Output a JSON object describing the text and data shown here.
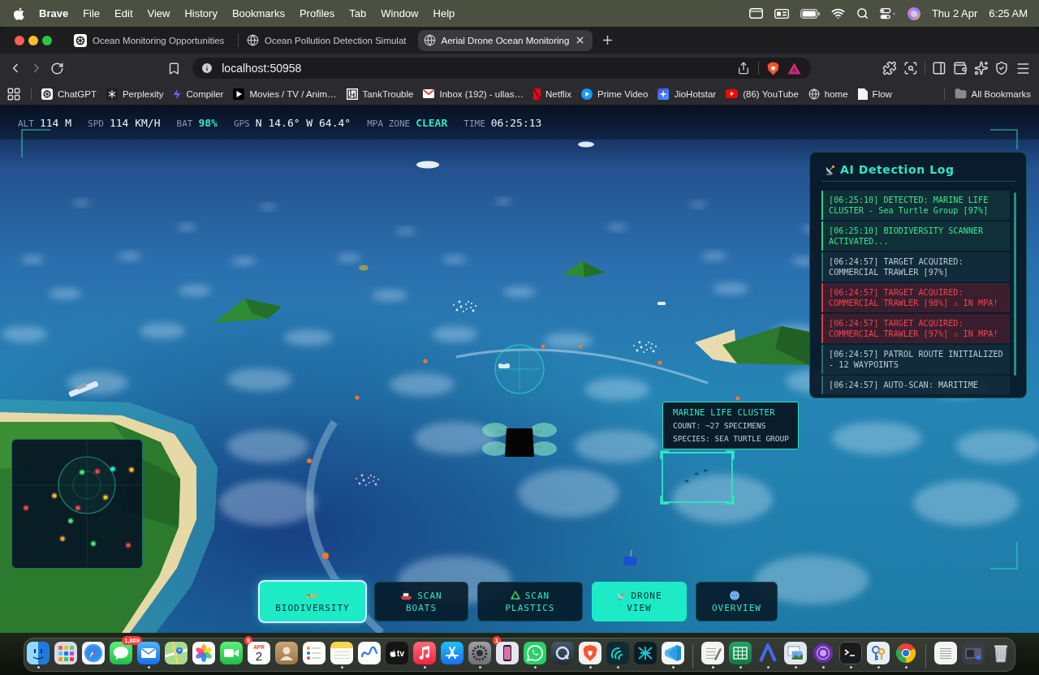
{
  "menu_bar": {
    "app_name": "Brave",
    "menus": [
      "File",
      "Edit",
      "View",
      "History",
      "Bookmarks",
      "Profiles",
      "Tab",
      "Window",
      "Help"
    ],
    "date": "Thu 2 Apr",
    "time": "6:25 AM"
  },
  "browser": {
    "tabs": [
      {
        "title": "Ocean Monitoring Opportunities",
        "selected": false
      },
      {
        "title": "Ocean Pollution Detection Simulat",
        "selected": false
      },
      {
        "title": "Aerial Drone Ocean Monitoring",
        "selected": true
      }
    ],
    "address": "localhost:50958",
    "bookmarks": [
      "ChatGPT",
      "Perplexity",
      "Compiler",
      "Movies / TV / Anim…",
      "TankTrouble",
      "Inbox (192) - ullas…",
      "Netflix",
      "Prime Video",
      "JioHotstar",
      "(86) YouTube",
      "home",
      "Flow"
    ],
    "all_bookmarks": "All Bookmarks"
  },
  "hud": {
    "readouts": [
      {
        "label": "ALT",
        "value": "114 M",
        "highlight": false
      },
      {
        "label": "SPD",
        "value": "114 KM/H",
        "highlight": false
      },
      {
        "label": "BAT",
        "value": "98%",
        "highlight": true
      },
      {
        "label": "GPS",
        "value": "N 14.6° W 64.4°",
        "highlight": false
      },
      {
        "label": "MPA ZONE",
        "value": "CLEAR",
        "highlight": true
      },
      {
        "label": "TIME",
        "value": "06:25:13",
        "highlight": false
      }
    ]
  },
  "detection_log": {
    "title": "AI Detection Log",
    "entries": [
      {
        "kind": "success",
        "text": "[06:25:10] DETECTED: MARINE LIFE CLUSTER - Sea Turtle Group [97%]"
      },
      {
        "kind": "success",
        "text": "[06:25:10] BIODIVERSITY SCANNER ACTIVATED..."
      },
      {
        "kind": "info",
        "text": "[06:24:57] TARGET ACQUIRED: COMMERCIAL TRAWLER [97%]"
      },
      {
        "kind": "alert",
        "text": "[06:24:57] TARGET ACQUIRED: COMMERCIAL TRAWLER [98%] ⚠ IN MPA!"
      },
      {
        "kind": "alert",
        "text": "[06:24:57] TARGET ACQUIRED: COMMERCIAL TRAWLER [97%] ⚠ IN MPA!"
      },
      {
        "kind": "info",
        "text": "[06:24:57] PATROL ROUTE INITIALIZED - 12 WAYPOINTS"
      },
      {
        "kind": "info",
        "text": "[06:24:57] AUTO-SCAN: MARITIME"
      }
    ]
  },
  "target_tooltip": {
    "title": "MARINE LIFE CLUSTER",
    "lines": [
      "COUNT: ~27 SPECIMENS",
      "SPECIES: SEA TURTLE GROUP"
    ]
  },
  "mode_buttons": [
    {
      "label": "BIODIVERSITY",
      "selected": true,
      "focused": true
    },
    {
      "label": "SCAN BOATS",
      "selected": false,
      "focused": false
    },
    {
      "label": "SCAN PLASTICS",
      "selected": false,
      "focused": false
    },
    {
      "label": "DRONE VIEW",
      "selected": true,
      "focused": false
    },
    {
      "label": "OVERVIEW",
      "selected": false,
      "focused": false
    }
  ],
  "dock": {
    "apps": [
      {
        "running": true
      },
      {
        "running": false
      },
      {
        "running": false
      },
      {
        "running": false,
        "badge": "1,869"
      },
      {
        "running": true
      },
      {
        "running": false
      },
      {
        "running": false
      },
      {
        "running": false,
        "badge": "9"
      },
      {
        "running": false,
        "month": "APR",
        "day": "2"
      },
      {
        "running": false
      },
      {
        "running": false
      },
      {
        "running": true
      },
      {
        "running": false
      },
      {
        "running": false,
        "label": "tv"
      },
      {
        "running": true
      },
      {
        "running": false
      },
      {
        "running": true,
        "badge": "1"
      },
      {
        "running": false
      },
      {
        "running": true
      },
      {
        "running": false
      },
      {
        "running": true
      },
      {
        "running": true
      },
      {
        "running": false
      },
      {
        "running": true
      },
      {
        "running": true
      },
      {
        "running": true
      },
      {
        "running": true
      },
      {
        "running": true
      },
      {
        "running": true
      },
      {
        "running": true
      },
      {
        "running": true
      },
      {
        "running": true
      },
      {
        "running": false
      },
      {
        "running": false
      },
      {
        "running": false
      }
    ]
  }
}
